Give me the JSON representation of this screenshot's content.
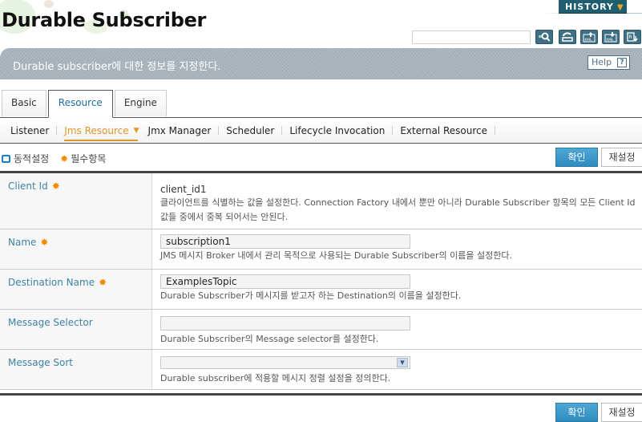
{
  "header": {
    "title": "Durable Subscriber",
    "history_label": "HISTORY",
    "search_placeholder": "",
    "toolbar_icons": [
      "search-icon",
      "refresh-icon",
      "xml-export-icon",
      "xml-import-icon",
      "resource-icon"
    ]
  },
  "description_bar": {
    "text": "Durable subscriber에 대한 정보를 지정한다.",
    "help_label": "Help",
    "help_glyph": "?"
  },
  "tabs": [
    {
      "label": "Basic",
      "active": false
    },
    {
      "label": "Resource",
      "active": true
    },
    {
      "label": "Engine",
      "active": false
    }
  ],
  "subnav": [
    {
      "label": "Listener",
      "active": false
    },
    {
      "label": "Jms Resource",
      "active": true
    },
    {
      "label": "Jmx Manager",
      "active": false
    },
    {
      "label": "Scheduler",
      "active": false
    },
    {
      "label": "Lifecycle Invocation",
      "active": false
    },
    {
      "label": "External Resource",
      "active": false
    }
  ],
  "legend": {
    "dynamic_label": "동적설정",
    "required_label": "필수항목",
    "required_glyph": "✸"
  },
  "buttons": {
    "ok": "확인",
    "reset": "재설정"
  },
  "fields": [
    {
      "label": "Client Id",
      "required": true,
      "type": "static",
      "value": "client_id1",
      "hint": "클라이언트를 식별하는 값을 설정한다. Connection Factory 내에서 뿐만 아니라 Durable Subscriber 항목의 모든 Client Id 값들 중에서 중복 되어서는 안된다."
    },
    {
      "label": "Name",
      "required": true,
      "type": "text",
      "value": "subscription1",
      "hint": "JMS 메시지 Broker 내에서 관리 목적으로 사용되는 Durable Subscriber의 이름을 설정한다."
    },
    {
      "label": "Destination Name",
      "required": true,
      "type": "text",
      "value": "ExamplesTopic",
      "hint": "Durable Subscriber가 메시지를 받고자 하는 Destination의 이름을 설정한다."
    },
    {
      "label": "Message Selector",
      "required": false,
      "type": "text",
      "value": "",
      "hint": "Durable Subscriber의 Message selector를 설정한다."
    },
    {
      "label": "Message Sort",
      "required": false,
      "type": "select",
      "value": "",
      "hint": "Durable subscriber에 적용할 메시지 정렬 설정을 정의한다."
    }
  ]
}
